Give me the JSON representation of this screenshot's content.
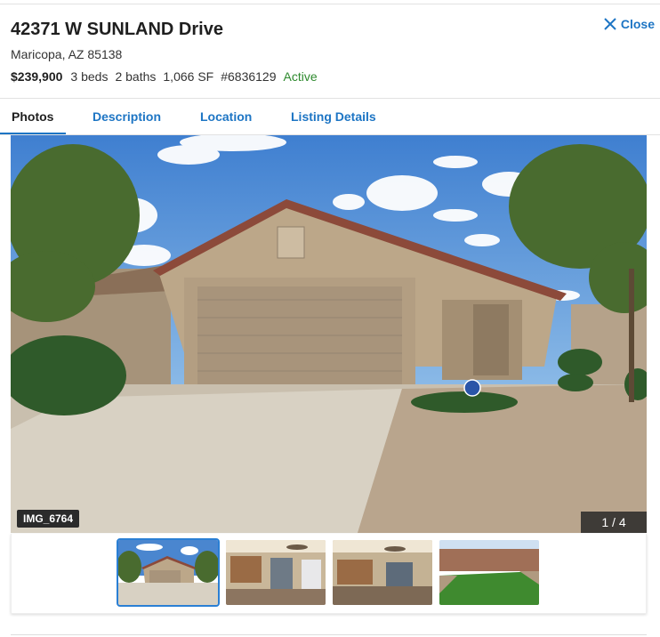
{
  "listing": {
    "address": "42371 W SUNLAND Drive",
    "city_line": "Maricopa, AZ 85138",
    "price": "$239,900",
    "beds": "3 beds",
    "baths": "2 baths",
    "sqft": "1,066 SF",
    "mls": "#6836129",
    "status": "Active"
  },
  "header": {
    "close_label": "Close"
  },
  "tabs": [
    {
      "label": "Photos",
      "active": true
    },
    {
      "label": "Description",
      "active": false
    },
    {
      "label": "Location",
      "active": false
    },
    {
      "label": "Listing Details",
      "active": false
    }
  ],
  "gallery": {
    "image_name": "IMG_6764",
    "counter": "1 / 4",
    "thumbnails": [
      {
        "name": "exterior-front",
        "selected": true
      },
      {
        "name": "interior-living",
        "selected": false
      },
      {
        "name": "interior-kitchen",
        "selected": false
      },
      {
        "name": "backyard",
        "selected": false
      }
    ]
  },
  "colors": {
    "link": "#1d75c4",
    "status": "#2e8a2e"
  }
}
